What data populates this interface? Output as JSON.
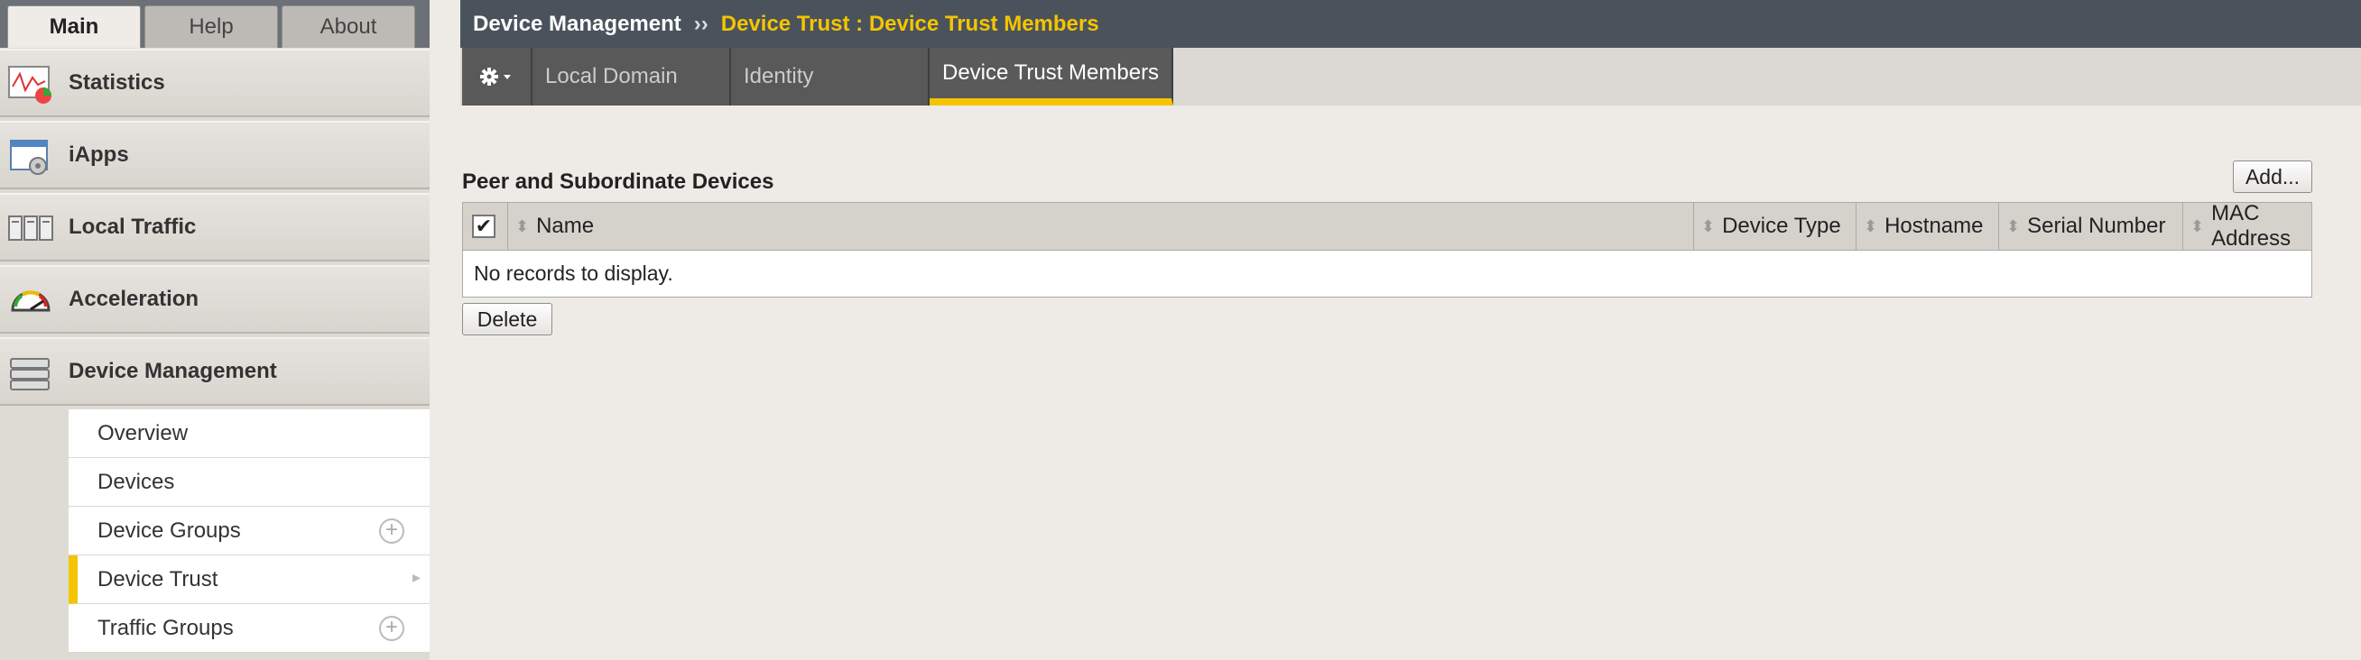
{
  "tabs": {
    "main": "Main",
    "help": "Help",
    "about": "About"
  },
  "sidebar": {
    "items": [
      {
        "label": "Statistics",
        "icon": "statistics-icon"
      },
      {
        "label": "iApps",
        "icon": "iapps-icon"
      },
      {
        "label": "Local Traffic",
        "icon": "local-traffic-icon"
      },
      {
        "label": "Acceleration",
        "icon": "acceleration-icon"
      },
      {
        "label": "Device Management",
        "icon": "device-management-icon"
      }
    ],
    "submenu": [
      {
        "label": "Overview"
      },
      {
        "label": "Devices"
      },
      {
        "label": "Device Groups",
        "has_add": true
      },
      {
        "label": "Device Trust",
        "selected": true,
        "has_arrow": true
      },
      {
        "label": "Traffic Groups",
        "has_add": true
      }
    ]
  },
  "breadcrumb": {
    "section": "Device Management",
    "separator": "››",
    "current": "Device Trust : Device Trust Members"
  },
  "subtabs": {
    "gear_icon": "gear-icon",
    "items": [
      "Local Domain",
      "Identity",
      "Device Trust Members"
    ],
    "active": "Device Trust Members"
  },
  "section": {
    "title": "Peer and Subordinate Devices",
    "add_label": "Add...",
    "delete_label": "Delete"
  },
  "table": {
    "columns": [
      "Name",
      "Device Type",
      "Hostname",
      "Serial Number",
      "MAC Address"
    ],
    "empty_text": "No records to display.",
    "select_all_checked": true
  },
  "colors": {
    "accent": "#f5c400",
    "header_bar": "#4a535c",
    "subtab_bg": "#595959"
  }
}
